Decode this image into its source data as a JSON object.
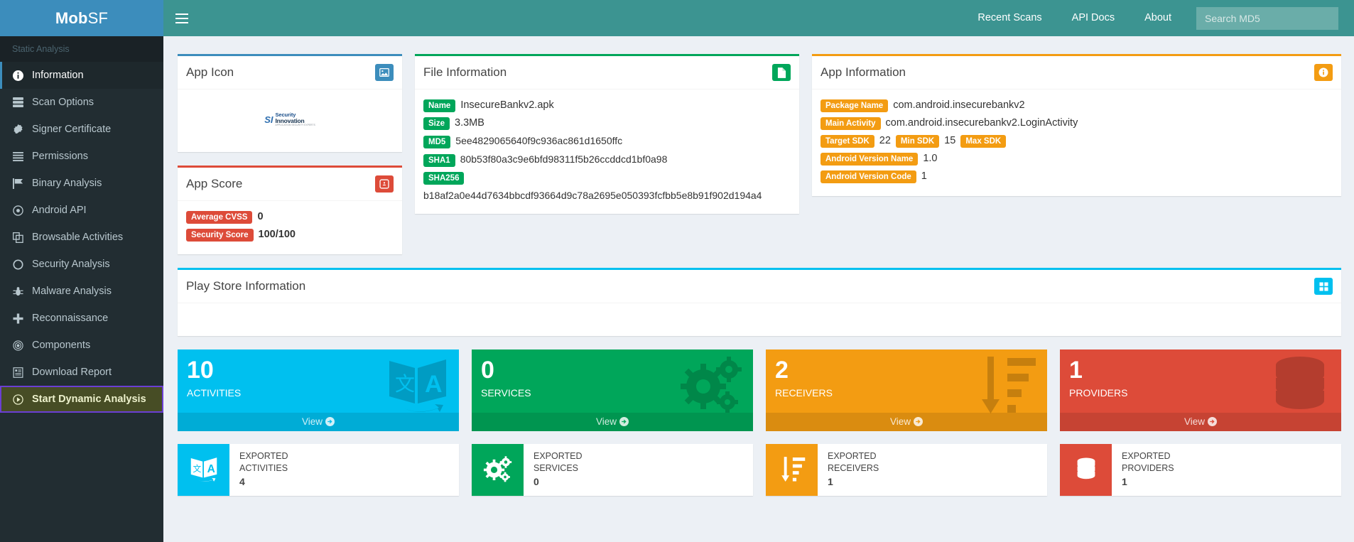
{
  "brand": {
    "bold": "Mob",
    "light": "SF"
  },
  "navbar": {
    "menu_icon": "hamburger-icon",
    "links": [
      {
        "label": "Recent Scans"
      },
      {
        "label": "API Docs"
      },
      {
        "label": "About"
      }
    ],
    "search": {
      "placeholder": "Search MD5",
      "value": ""
    }
  },
  "sidebar": {
    "header": "Static Analysis",
    "items": [
      {
        "label": "Information",
        "icon": "info-circle-icon",
        "state": "active"
      },
      {
        "label": "Scan Options",
        "icon": "server-icon",
        "state": ""
      },
      {
        "label": "Signer Certificate",
        "icon": "certificate-icon",
        "state": ""
      },
      {
        "label": "Permissions",
        "icon": "list-icon",
        "state": ""
      },
      {
        "label": "Binary Analysis",
        "icon": "flag-icon",
        "state": ""
      },
      {
        "label": "Android API",
        "icon": "dot-circle-icon",
        "state": ""
      },
      {
        "label": "Browsable Activities",
        "icon": "copy-icon",
        "state": ""
      },
      {
        "label": "Security Analysis",
        "icon": "circle-icon",
        "state": ""
      },
      {
        "label": "Malware Analysis",
        "icon": "bug-icon",
        "state": ""
      },
      {
        "label": "Reconnaissance",
        "icon": "plus-icon",
        "state": ""
      },
      {
        "label": "Components",
        "icon": "bullseye-icon",
        "state": ""
      },
      {
        "label": "Download Report",
        "icon": "file-report-icon",
        "state": ""
      },
      {
        "label": "Start Dynamic Analysis",
        "icon": "play-circle-icon",
        "state": "focused"
      }
    ]
  },
  "app_icon_card": {
    "title": "App Icon",
    "header_icon": "image-icon",
    "logo": {
      "mark": "SI",
      "line1": "Security",
      "line2": "Innovation",
      "line3": "APPLICATION SECURITY EXPERTS"
    }
  },
  "app_score_card": {
    "title": "App Score",
    "header_icon": "dashboard-icon",
    "rows": [
      {
        "badge": "Average CVSS",
        "value": "0",
        "bold": false
      },
      {
        "badge": "Security Score",
        "value": "100/100",
        "bold": true
      }
    ]
  },
  "file_info_card": {
    "title": "File Information",
    "header_icon": "file-icon",
    "rows": [
      {
        "badge": "Name",
        "value": "InsecureBankv2.apk"
      },
      {
        "badge": "Size",
        "value": "3.3MB"
      },
      {
        "badge": "MD5",
        "value": "5ee4829065640f9c936ac861d1650ffc"
      },
      {
        "badge": "SHA1",
        "value": "80b53f80a3c9e6bfd98311f5b26ccddcd1bf0a98"
      },
      {
        "badge": "SHA256",
        "value": "b18af2a0e44d7634bbcdf93664d9c78a2695e050393fcfbb5e8b91f902d194a4"
      }
    ]
  },
  "app_info_card": {
    "title": "App Information",
    "header_icon": "info-icon",
    "package_name_badge": "Package Name",
    "package_name_value": "com.android.insecurebankv2",
    "main_activity_badge": "Main Activity",
    "main_activity_value": "com.android.insecurebankv2.LoginActivity",
    "target_sdk_badge": "Target SDK",
    "target_sdk_value": "22",
    "min_sdk_badge": "Min SDK",
    "min_sdk_value": "15",
    "max_sdk_badge": "Max SDK",
    "max_sdk_value": "",
    "version_name_badge": "Android Version Name",
    "version_name_value": "1.0",
    "version_code_badge": "Android Version Code",
    "version_code_value": "1"
  },
  "play_store_card": {
    "title": "Play Store Information",
    "header_icon": "google-play-icon"
  },
  "tiles": [
    {
      "number": "10",
      "label": "ACTIVITIES",
      "color": "cyan",
      "view": "View",
      "art": "translate-icon"
    },
    {
      "number": "0",
      "label": "SERVICES",
      "color": "green",
      "view": "View",
      "art": "cogs-icon"
    },
    {
      "number": "2",
      "label": "RECEIVERS",
      "color": "orange",
      "view": "View",
      "art": "sort-amount-down-icon"
    },
    {
      "number": "1",
      "label": "PROVIDERS",
      "color": "red",
      "view": "View",
      "art": "database-icon"
    }
  ],
  "exported": [
    {
      "line1": "EXPORTED",
      "line2": "ACTIVITIES",
      "number": "4",
      "color": "cyan",
      "icon": "translate-icon"
    },
    {
      "line1": "EXPORTED",
      "line2": "SERVICES",
      "number": "0",
      "color": "green",
      "icon": "cogs-icon"
    },
    {
      "line1": "EXPORTED",
      "line2": "RECEIVERS",
      "number": "1",
      "color": "orange",
      "icon": "sort-amount-down-icon"
    },
    {
      "line1": "EXPORTED",
      "line2": "PROVIDERS",
      "number": "1",
      "color": "red",
      "icon": "database-icon"
    }
  ],
  "colors": {
    "brand_blue": "#3c8dbc",
    "navbar_teal": "#3c9491",
    "sidebar_dark": "#222d32",
    "cyan": "#00c0ef",
    "green": "#00a65a",
    "orange": "#f39c12",
    "red": "#dd4b39",
    "focus_outline": "#6b3fd4",
    "focus_fill": "#474d25",
    "page_bg": "#ecf0f5"
  }
}
